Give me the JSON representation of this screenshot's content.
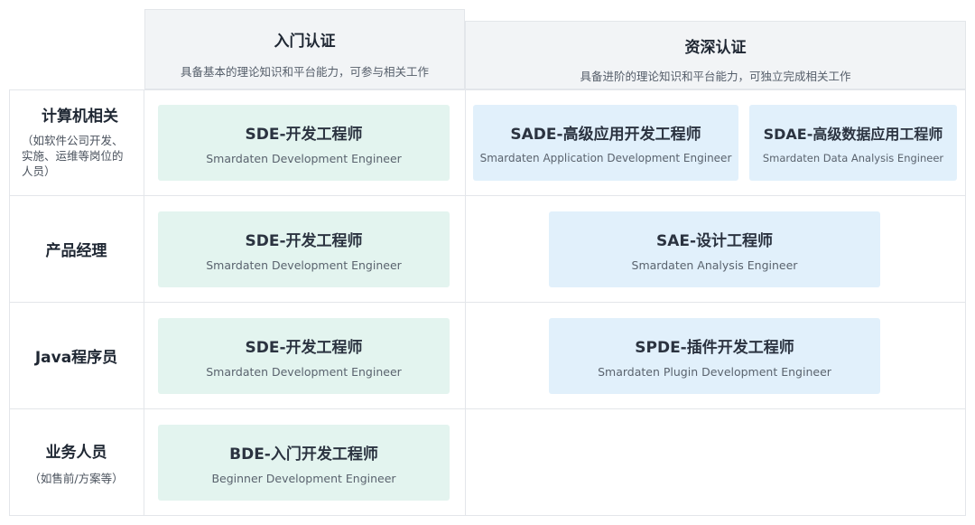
{
  "header": {
    "entry": {
      "title": "入门认证",
      "subtitle": "具备基本的理论知识和平台能力，可参与相关工作"
    },
    "senior": {
      "title": "资深认证",
      "subtitle": "具备进阶的理论知识和平台能力，可独立完成相关工作"
    }
  },
  "rows": [
    {
      "title": "计算机相关",
      "note": "（如软件公司开发、实施、运维等岗位的人员）"
    },
    {
      "title": "产品经理"
    },
    {
      "title": "Java程序员"
    },
    {
      "title": "业务人员",
      "note": "（如售前/方案等）"
    }
  ],
  "cards": {
    "sde1": {
      "title": "SDE-开发工程师",
      "subtitle": "Smardaten Development Engineer"
    },
    "sade": {
      "title": "SADE-高级应用开发工程师",
      "subtitle": "Smardaten Application Development Engineer"
    },
    "sdae": {
      "title": "SDAE-高级数据应用工程师",
      "subtitle": "Smardaten Data Analysis Engineer"
    },
    "sde2": {
      "title": "SDE-开发工程师",
      "subtitle": "Smardaten Development Engineer"
    },
    "sae": {
      "title": "SAE-设计工程师",
      "subtitle": "Smardaten Analysis Engineer"
    },
    "sde3": {
      "title": "SDE-开发工程师",
      "subtitle": "Smardaten Development Engineer"
    },
    "spde": {
      "title": "SPDE-插件开发工程师",
      "subtitle": "Smardaten Plugin Development Engineer"
    },
    "bde": {
      "title": "BDE-入门开发工程师",
      "subtitle": "Beginner Development Engineer"
    }
  }
}
